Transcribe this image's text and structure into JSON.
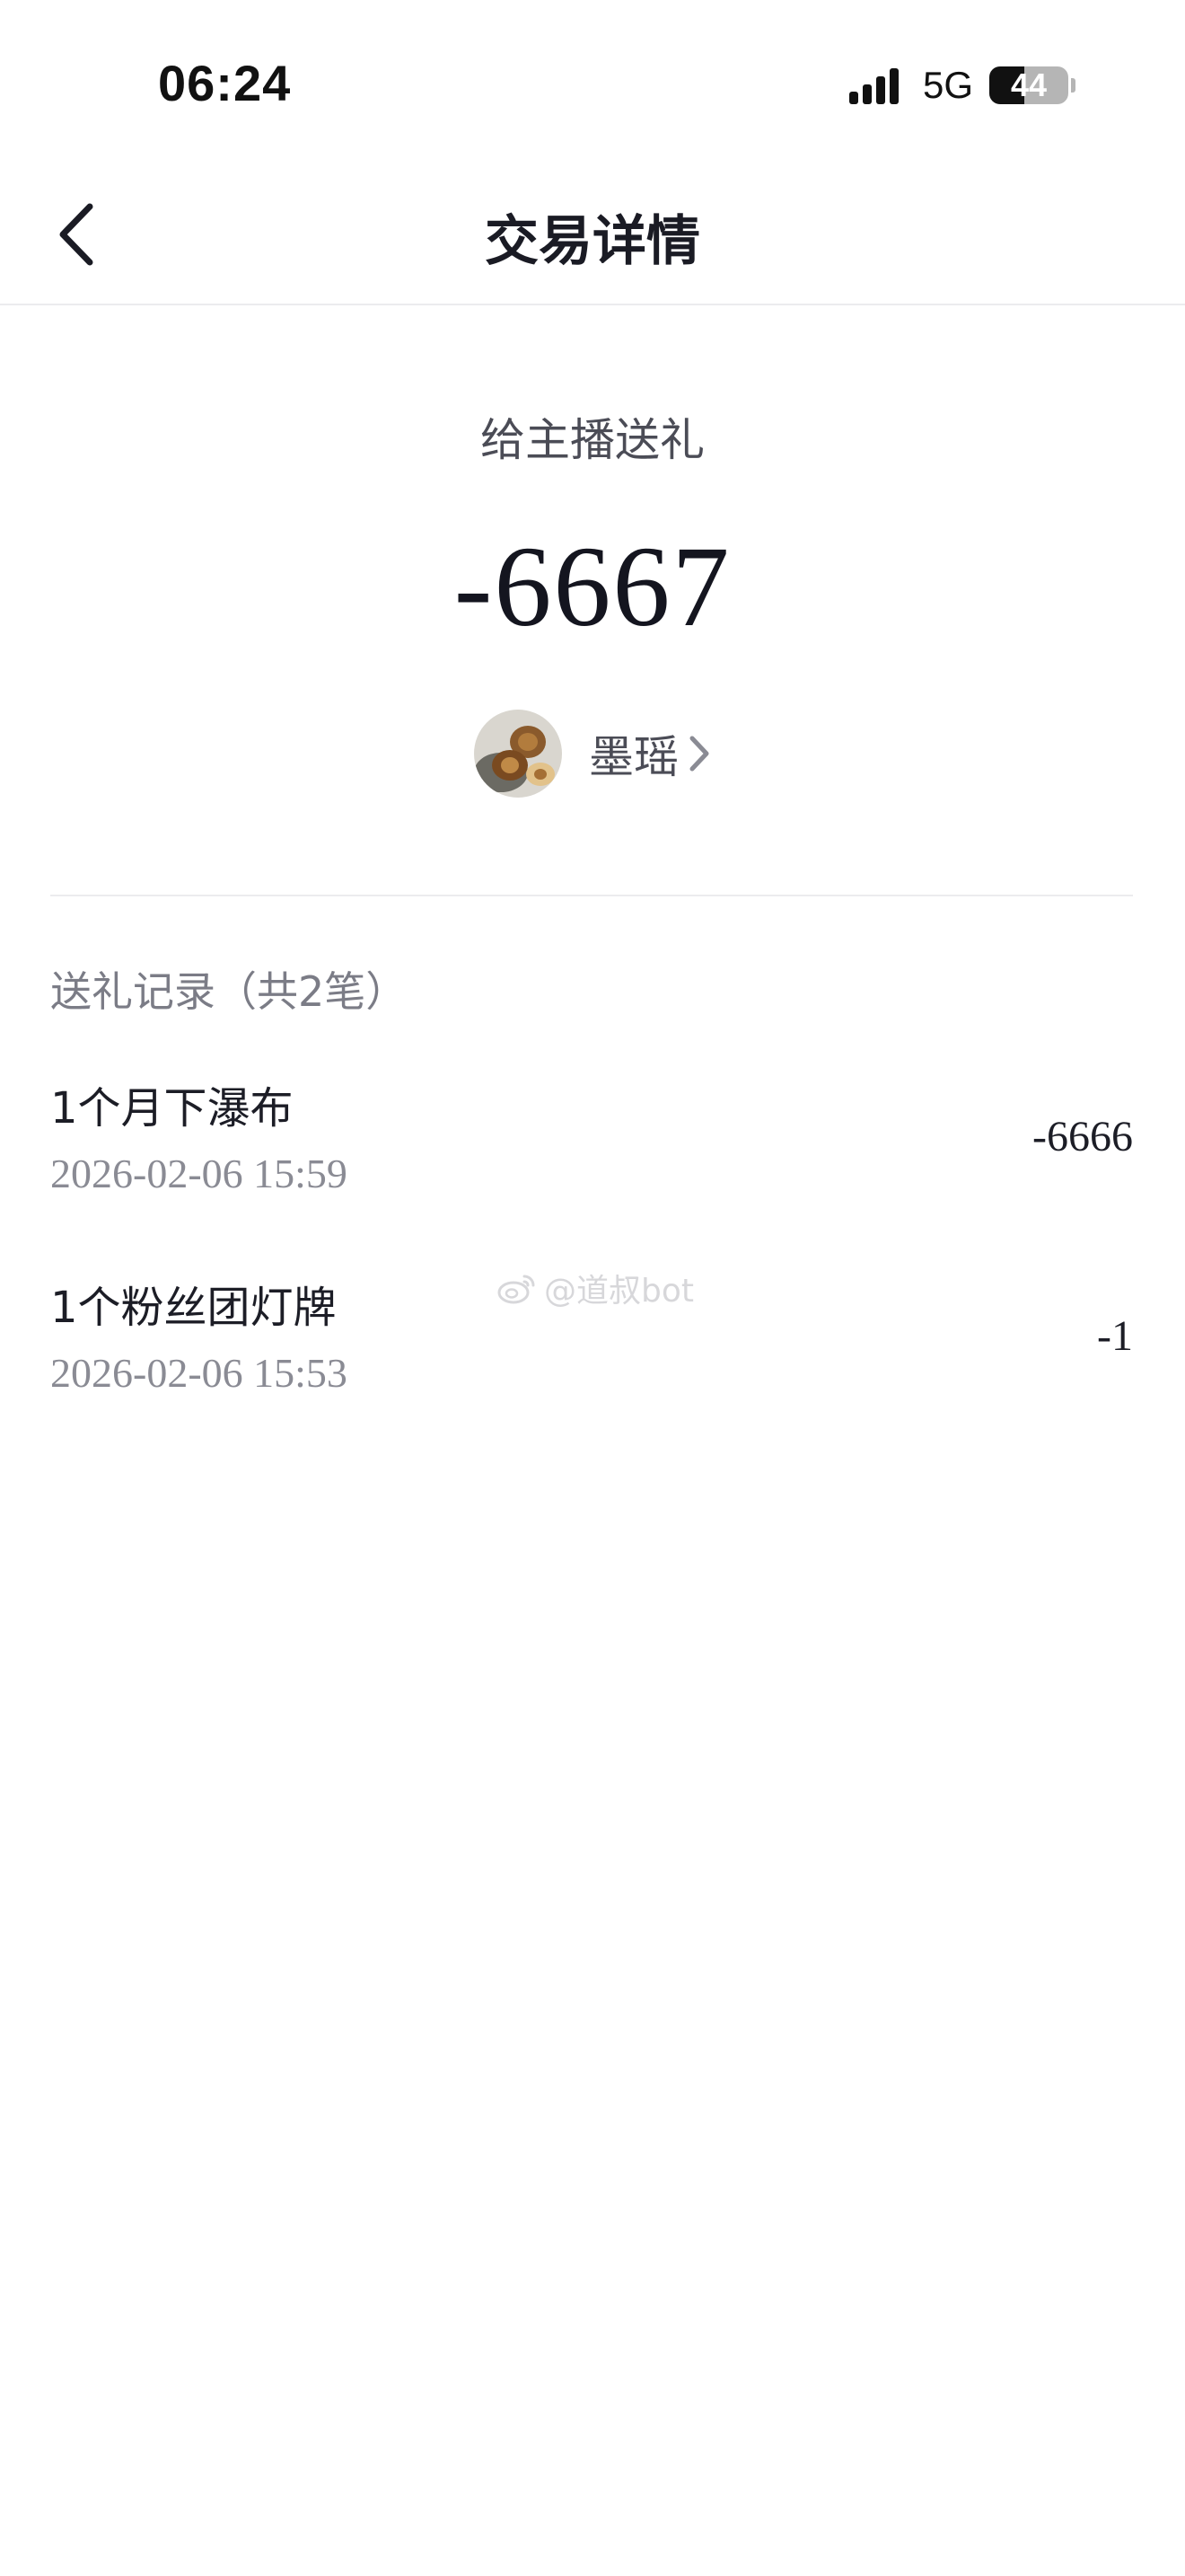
{
  "status_bar": {
    "time": "06:24",
    "network": "5G",
    "battery_level": "44",
    "battery_fraction": 0.44,
    "signal_bars": 4
  },
  "nav": {
    "back_icon": "chevron-left-icon",
    "title": "交易详情"
  },
  "summary": {
    "type_label": "给主播送礼",
    "amount": "-6667",
    "recipient_name": "墨瑶",
    "recipient_chevron_icon": "chevron-right-icon"
  },
  "records": {
    "header": "送礼记录（共2笔）",
    "items": [
      {
        "name": "1个月下瀑布",
        "time": "2026-02-06 15:59",
        "amount": "-6666"
      },
      {
        "name": "1个粉丝团灯牌",
        "time": "2026-02-06 15:53",
        "amount": "-1"
      }
    ]
  },
  "watermark": {
    "text": "@道叔bot",
    "icon": "weibo-icon"
  },
  "colors": {
    "background": "#ffffff",
    "primary_text": "#14151f",
    "secondary_text": "#7b7c86",
    "divider": "#ececee"
  }
}
